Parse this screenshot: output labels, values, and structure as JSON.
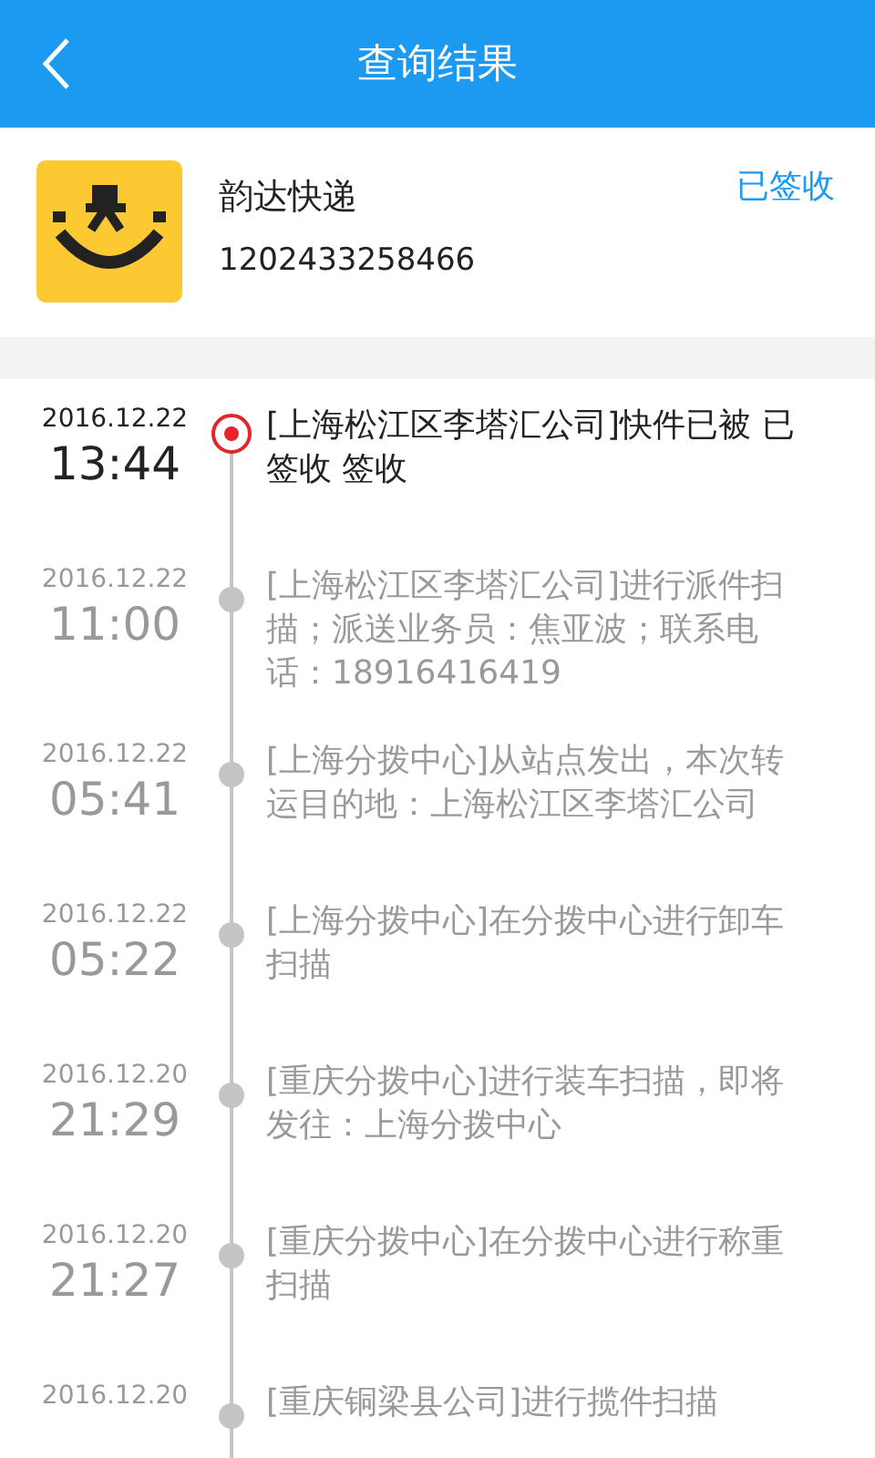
{
  "header": {
    "title": "查询结果"
  },
  "parcel": {
    "company": "韵达快递",
    "number": "1202433258466",
    "status": "已签收"
  },
  "events": [
    {
      "date": "2016.12.22",
      "time": "13:44",
      "text": "[上海松江区李塔汇公司]快件已被 已签收 签收",
      "current": true
    },
    {
      "date": "2016.12.22",
      "time": "11:00",
      "text": "[上海松江区李塔汇公司]进行派件扫描；派送业务员：焦亚波；联系电话：18916416419",
      "current": false
    },
    {
      "date": "2016.12.22",
      "time": "05:41",
      "text": "[上海分拨中心]从站点发出，本次转运目的地：上海松江区李塔汇公司",
      "current": false
    },
    {
      "date": "2016.12.22",
      "time": "05:22",
      "text": "[上海分拨中心]在分拨中心进行卸车扫描",
      "current": false
    },
    {
      "date": "2016.12.20",
      "time": "21:29",
      "text": "[重庆分拨中心]进行装车扫描，即将发往：上海分拨中心",
      "current": false
    },
    {
      "date": "2016.12.20",
      "time": "21:27",
      "text": "[重庆分拨中心]在分拨中心进行称重扫描",
      "current": false
    },
    {
      "date": "2016.12.20",
      "text": "[重庆铜梁县公司]进行揽件扫描",
      "current": false
    }
  ]
}
